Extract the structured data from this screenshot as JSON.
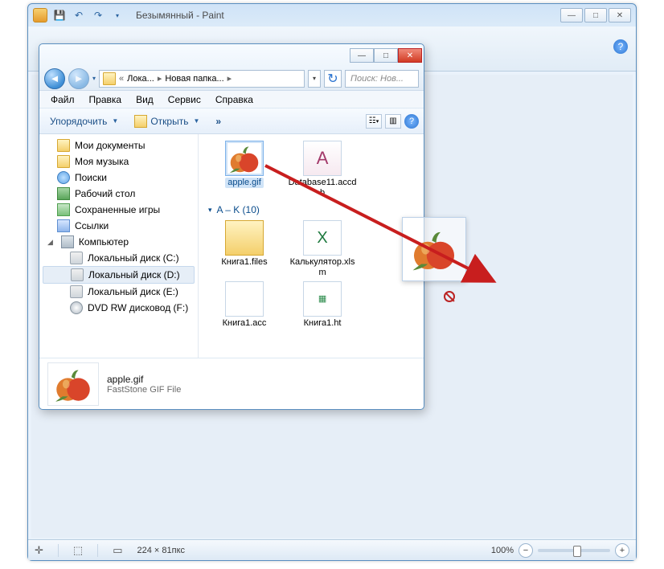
{
  "paint": {
    "title": "Безымянный - Paint",
    "status": {
      "canvas_size": "224 × 81пкс",
      "zoom": "100%"
    }
  },
  "explorer": {
    "breadcrumb": {
      "seg1": "Лока...",
      "seg2": "Новая папка..."
    },
    "search_placeholder": "Поиск: Нов...",
    "menu": {
      "file": "Файл",
      "edit": "Правка",
      "view": "Вид",
      "tools": "Сервис",
      "help": "Справка"
    },
    "toolbar": {
      "organize": "Упорядочить",
      "open": "Открыть",
      "overflow": "»"
    },
    "tree": {
      "mydocs": "Мои документы",
      "mymusic": "Моя музыка",
      "searches": "Поиски",
      "desktop": "Рабочий стол",
      "savedgames": "Сохраненные игры",
      "links": "Ссылки",
      "computer": "Компьютер",
      "drive_c": "Локальный диск (C:)",
      "drive_d": "Локальный диск (D:)",
      "drive_e": "Локальный диск (E:)",
      "dvd_f": "DVD RW дисковод (F:)"
    },
    "files": {
      "apple": "apple.gif",
      "database": "Database11.accdb",
      "group_ak": "A – K (10)",
      "kniga_files": "Книга1.files",
      "calc": "Калькулятор.xlsm",
      "kniga_acc": "Книга1.acc",
      "kniga_ht": "Книга1.ht"
    },
    "details": {
      "name": "apple.gif",
      "type": "FastStone GIF File"
    }
  }
}
